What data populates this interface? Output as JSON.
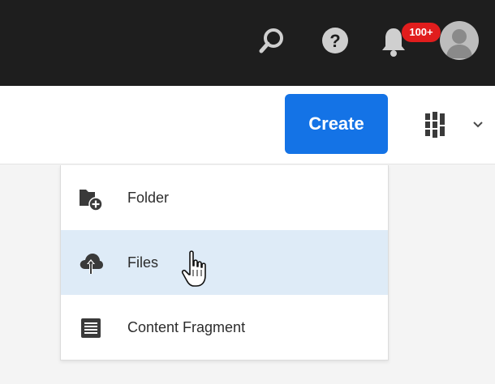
{
  "header": {
    "notification_count": "100+",
    "icons": [
      "search-icon",
      "help-icon",
      "bell-icon",
      "avatar"
    ]
  },
  "toolbar": {
    "create_label": "Create",
    "view_switch_icon": "view-grid-icon"
  },
  "create_menu": {
    "items": [
      {
        "label": "Folder",
        "icon": "folder-add-icon"
      },
      {
        "label": "Files",
        "icon": "upload-cloud-icon"
      },
      {
        "label": "Content Fragment",
        "icon": "content-fragment-icon"
      }
    ],
    "highlighted": "Files"
  },
  "colors": {
    "topbar": "#1e1e1e",
    "accent": "#1473e6",
    "badge": "#e11d1d",
    "menu_hover": "#deebf7"
  }
}
